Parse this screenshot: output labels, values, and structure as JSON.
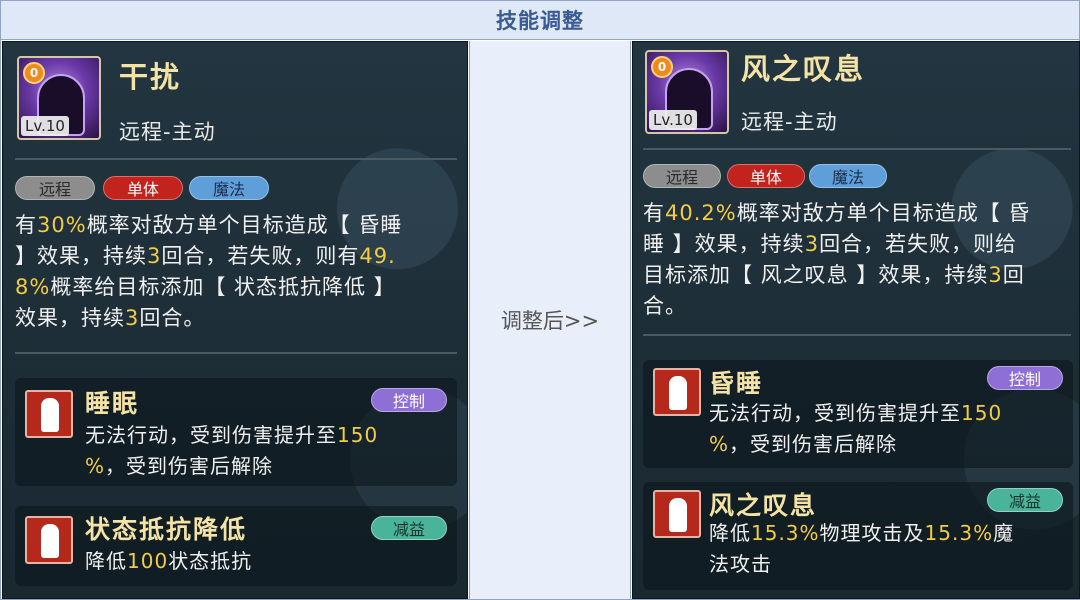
{
  "header": {
    "title": "技能调整"
  },
  "middle": {
    "label": "调整后>>"
  },
  "colors": {
    "highlight": "#f3cc43",
    "panel_bg": "#1d2b33",
    "header_bg": "#dfe8f7",
    "header_text": "#3a5a93"
  },
  "left": {
    "icon": {
      "name": "dark-spirit-skill-icon",
      "badge": "0",
      "level": "Lv.10"
    },
    "name": "干扰",
    "subtitle": "远程-主动",
    "tags": [
      "远程",
      "单体",
      "魔法"
    ],
    "desc_parts": [
      "有",
      "30%",
      "概率对敌方单个目标造成【 昏睡",
      "】效果，持续",
      "3",
      "回合，若失败，则有",
      "49.",
      "8%",
      "概率给目标添加【 状态抵抗降低 】",
      "效果，持续",
      "3",
      "回合。"
    ],
    "statuses": [
      {
        "name": "睡眠",
        "tag": "控制",
        "desc_parts": [
          "无法行动，受到伤害提升至",
          "150",
          "%",
          "，受到伤害后解除"
        ]
      },
      {
        "name": "状态抵抗降低",
        "tag": "减益",
        "desc_parts": [
          "降低",
          "100",
          "状态抵抗"
        ]
      }
    ]
  },
  "right": {
    "icon": {
      "name": "dark-spirit-skill-icon",
      "badge": "0",
      "level": "Lv.10"
    },
    "name": "风之叹息",
    "subtitle": "远程-主动",
    "tags": [
      "远程",
      "单体",
      "魔法"
    ],
    "desc_parts": [
      "有",
      "40.2%",
      "概率对敌方单个目标造成【 昏",
      "睡 】效果，持续",
      "3",
      "回合，若失败，则给",
      "目标添加【 风之叹息 】效果，持续",
      "3",
      "回",
      "合。"
    ],
    "statuses": [
      {
        "name": "昏睡",
        "tag": "控制",
        "desc_parts": [
          "无法行动，受到伤害提升至",
          "150",
          "%",
          "，受到伤害后解除"
        ]
      },
      {
        "name": "风之叹息",
        "tag": "减益",
        "desc_parts": [
          "降低",
          "15.3%",
          "物理攻击及",
          "15.3%",
          "魔",
          "法攻击"
        ]
      }
    ]
  }
}
